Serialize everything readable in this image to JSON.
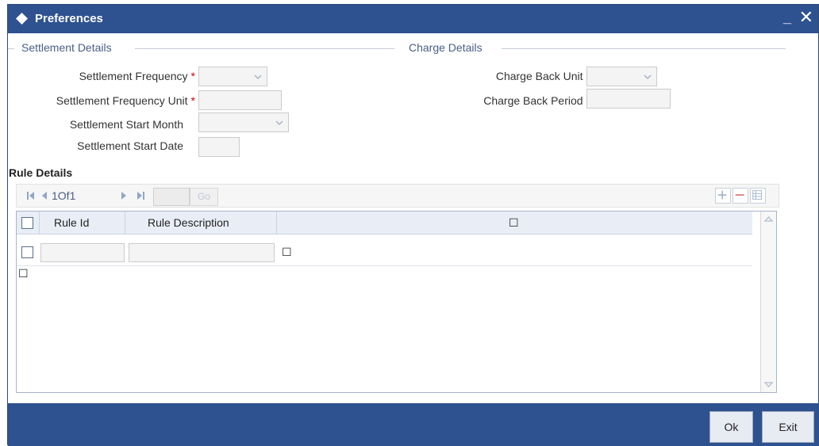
{
  "window": {
    "title": "Preferences",
    "minimize_label": "_",
    "close_label": "✕"
  },
  "settlement": {
    "title": "Settlement Details",
    "frequency_label": "Settlement Frequency",
    "frequency_unit_label": "Settlement Frequency Unit",
    "start_month_label": "Settlement Start Month",
    "start_date_label": "Settlement Start Date",
    "required_mark": "*"
  },
  "charge": {
    "title": "Charge Details",
    "back_unit_label": "Charge Back Unit",
    "back_period_label": "Charge Back Period",
    "required_mark": "*"
  },
  "rules": {
    "title": "Rule Details",
    "pager": {
      "count_text": "1Of1",
      "go_label": "Go"
    },
    "columns": [
      "Rule Id",
      "Rule Description"
    ],
    "extra_column_glyph": "☐",
    "row_glyph": "☐",
    "below_glyph": "☐"
  },
  "footer": {
    "ok_label": "Ok",
    "exit_label": "Exit"
  },
  "colors": {
    "titlebar": "#2e5190",
    "section_title": "#4a5e86",
    "required": "#cc0000"
  },
  "icons": [
    "diamond-icon",
    "first-page-icon",
    "prev-page-icon",
    "next-page-icon",
    "last-page-icon",
    "add-row-icon",
    "delete-row-icon",
    "single-view-icon",
    "scroll-up-icon",
    "scroll-down-icon",
    "dropdown-arrow-icon"
  ]
}
